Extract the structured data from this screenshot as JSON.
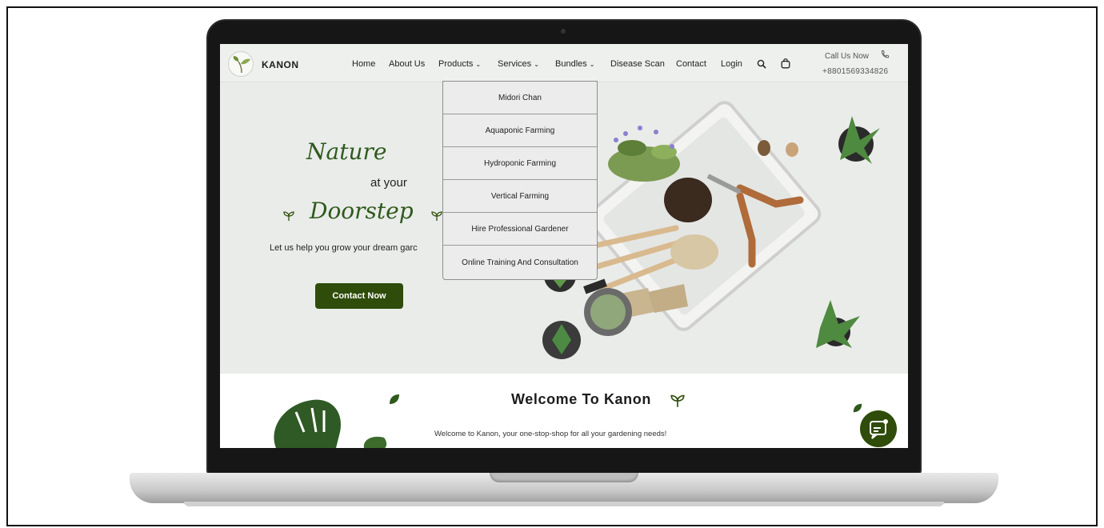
{
  "brand": {
    "name": "KANON"
  },
  "nav": {
    "items": [
      {
        "label": "Home",
        "dropdown": false
      },
      {
        "label": "About Us",
        "dropdown": false
      },
      {
        "label": "Products",
        "dropdown": true
      },
      {
        "label": "Services",
        "dropdown": true
      },
      {
        "label": "Bundles",
        "dropdown": true
      },
      {
        "label": "Disease Scan",
        "dropdown": false
      },
      {
        "label": "Contact",
        "dropdown": false
      },
      {
        "label": "Login",
        "dropdown": false
      }
    ],
    "search_icon": "search-icon",
    "cart_icon": "shopping-bag-icon"
  },
  "call": {
    "label": "Call Us Now",
    "number": "+8801569334826",
    "icon": "phone-icon"
  },
  "dropdown": {
    "items": [
      "Midori Chan",
      "Aquaponic Farming",
      "Hydroponic Farming",
      "Vertical Farming",
      "Hire Professional Gardener",
      "Online Training And Consultation"
    ]
  },
  "hero": {
    "line1": "Nature",
    "line2": "at your",
    "line3": "Doorstep",
    "subtitle": "Let us help you grow your dream garc",
    "cta_label": "Contact Now"
  },
  "welcome": {
    "title": "Welcome To Kanon",
    "text": "Welcome to Kanon, your one-stop-shop for all your gardening needs!"
  },
  "colors": {
    "brand_green": "#2f4c0a",
    "script_green": "#2f5a1d",
    "hero_bg": "#eaecea"
  }
}
